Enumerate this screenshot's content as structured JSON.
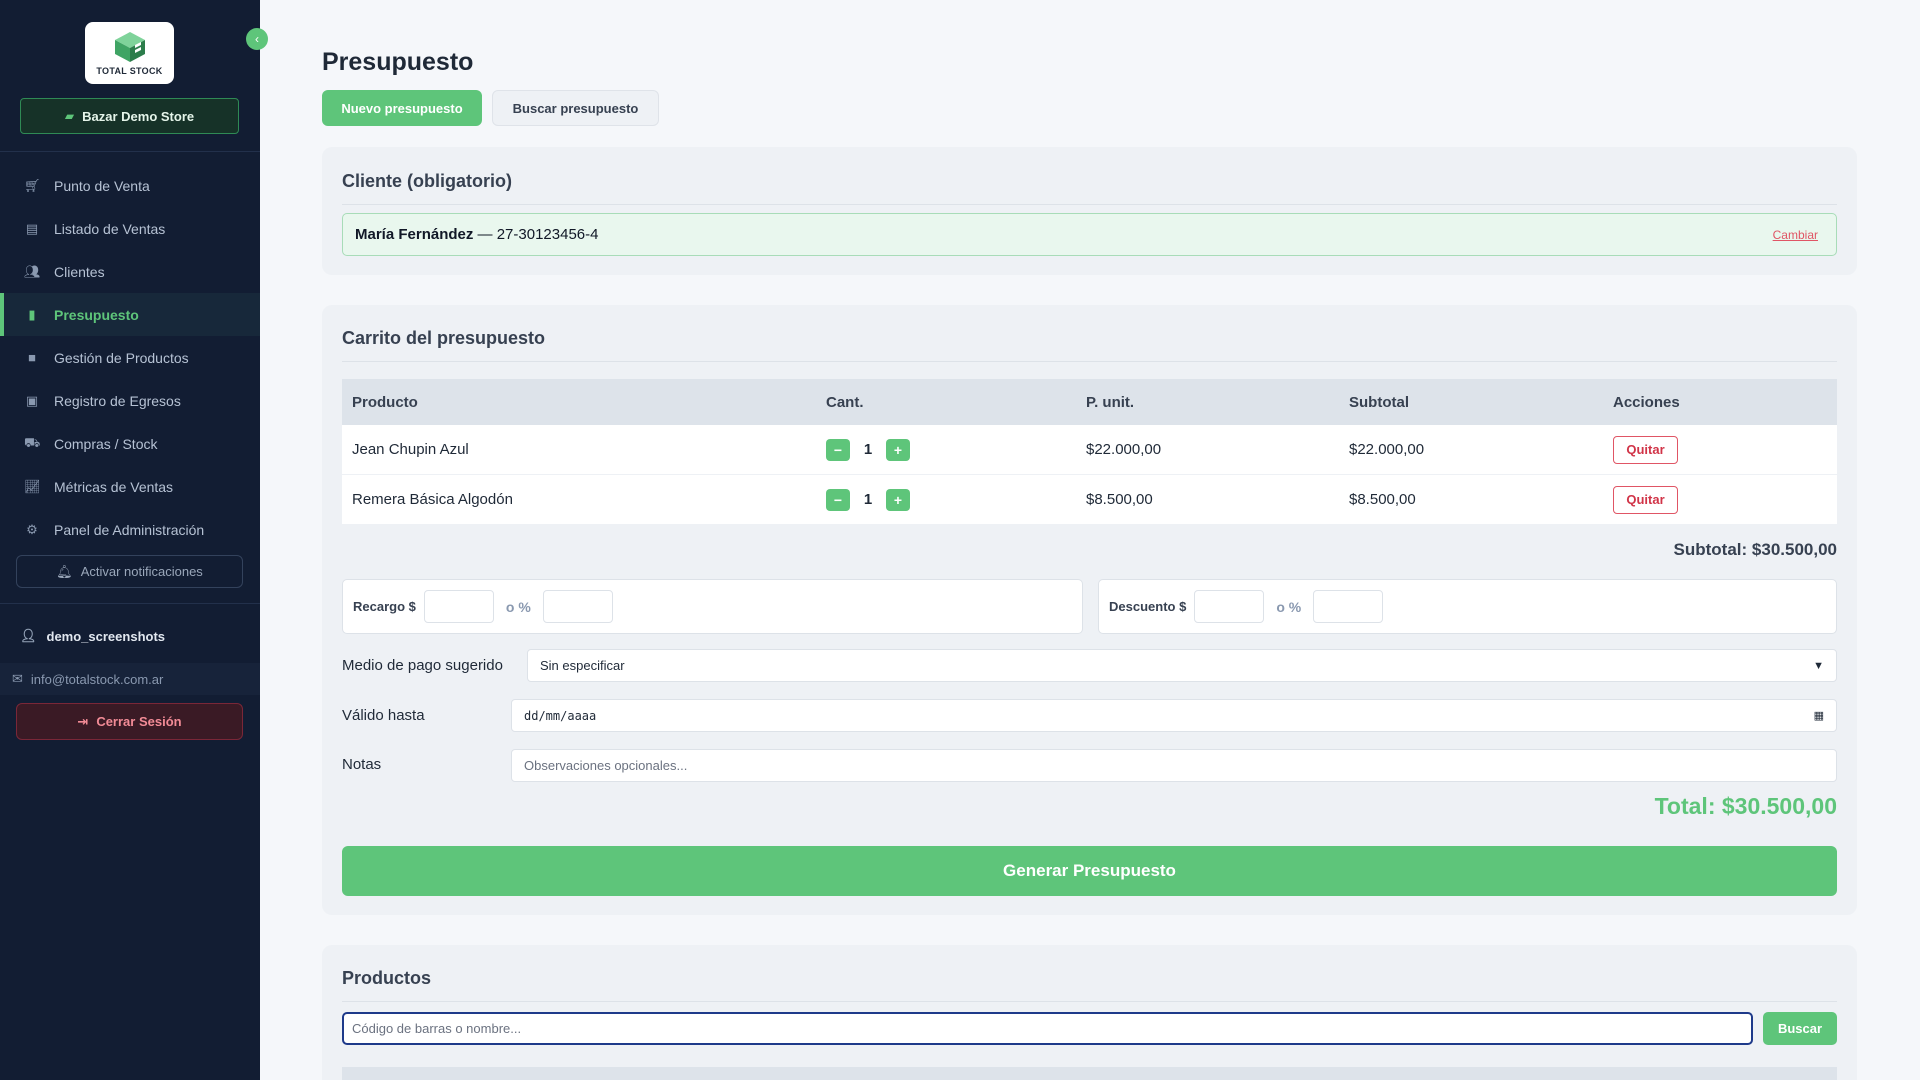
{
  "sidebar": {
    "logo_text": "TOTAL STOCK",
    "store_name": "Bazar Demo Store",
    "items": [
      {
        "label": "Punto de Venta"
      },
      {
        "label": "Listado de Ventas"
      },
      {
        "label": "Clientes"
      },
      {
        "label": "Presupuesto"
      },
      {
        "label": "Gestión de Productos"
      },
      {
        "label": "Registro de Egresos"
      },
      {
        "label": "Compras / Stock"
      },
      {
        "label": "Métricas de Ventas"
      },
      {
        "label": "Panel de Administración"
      }
    ],
    "notifications_label": "Activar notificaciones",
    "username": "demo_screenshots",
    "email": "info@totalstock.com.ar",
    "logout_label": "Cerrar Sesión"
  },
  "page": {
    "title": "Presupuesto",
    "tab_new": "Nuevo presupuesto",
    "tab_search": "Buscar presupuesto"
  },
  "client": {
    "section_title": "Cliente (obligatorio)",
    "name": "María Fernández",
    "separator": " — ",
    "tax_id": "27-30123456-4",
    "change_label": "Cambiar"
  },
  "cart": {
    "section_title": "Carrito del presupuesto",
    "columns": [
      "Producto",
      "Cant.",
      "P. unit.",
      "Subtotal",
      "Acciones"
    ],
    "rows": [
      {
        "product": "Jean Chupin Azul",
        "qty": "1",
        "unit_price": "$22.000,00",
        "subtotal": "$22.000,00",
        "action": "Quitar"
      },
      {
        "product": "Remera Básica Algodón",
        "qty": "1",
        "unit_price": "$8.500,00",
        "subtotal": "$8.500,00",
        "action": "Quitar"
      }
    ],
    "minus": "−",
    "plus": "+",
    "subtotal_text": "Subtotal: $30.500,00",
    "surcharge_label": "Recargo $",
    "discount_label": "Descuento $",
    "or_pct": "o %",
    "payment_label": "Medio de pago sugerido",
    "payment_value": "Sin especificar",
    "valid_label": "Válido hasta",
    "valid_value": "dd/mm/aaaa",
    "notes_label": "Notas",
    "notes_placeholder": "Observaciones opcionales...",
    "total_text": "Total: $30.500,00",
    "generate_label": "Generar Presupuesto"
  },
  "products": {
    "section_title": "Productos",
    "search_placeholder": "Código de barras o nombre...",
    "search_button": "Buscar"
  },
  "colors": {
    "accent": "#5ec57a",
    "sidebar_bg": "#121d33",
    "danger": "#e05565"
  }
}
